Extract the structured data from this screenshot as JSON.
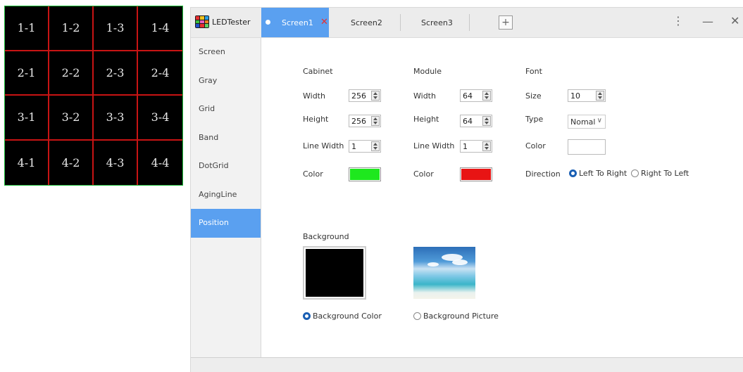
{
  "led_grid": {
    "cells": [
      "1-1",
      "1-2",
      "1-3",
      "1-4",
      "2-1",
      "2-2",
      "2-3",
      "2-4",
      "3-1",
      "3-2",
      "3-3",
      "3-4",
      "4-1",
      "4-2",
      "4-3",
      "4-4"
    ],
    "background_color": "#000000",
    "line_color": "#c81414",
    "border_color": "#1bbf3a"
  },
  "app": {
    "title": "LEDTester",
    "tabs": [
      {
        "label": "Screen1",
        "active": true
      },
      {
        "label": "Screen2",
        "active": false
      },
      {
        "label": "Screen3",
        "active": false
      }
    ],
    "add_tab_label": "+",
    "window_buttons": {
      "menu": "⋮",
      "minimize": "—",
      "close": "✕"
    },
    "tab_close": "✕"
  },
  "sidebar": {
    "items": [
      {
        "label": "Screen",
        "active": false
      },
      {
        "label": "Gray",
        "active": false
      },
      {
        "label": "Grid",
        "active": false
      },
      {
        "label": "Band",
        "active": false
      },
      {
        "label": "DotGrid",
        "active": false
      },
      {
        "label": "AgingLine",
        "active": false
      },
      {
        "label": "Position",
        "active": true
      }
    ]
  },
  "cabinet": {
    "title": "Cabinet",
    "width_label": "Width",
    "width": "256",
    "height_label": "Height",
    "height": "256",
    "line_width_label": "Line Width",
    "line_width": "1",
    "color_label": "Color",
    "color": "#1ee81e"
  },
  "module": {
    "title": "Module",
    "width_label": "Width",
    "width": "64",
    "height_label": "Height",
    "height": "64",
    "line_width_label": "Line Width",
    "line_width": "1",
    "color_label": "Color",
    "color": "#e81414"
  },
  "font": {
    "title": "Font",
    "size_label": "Size",
    "size": "10",
    "type_label": "Type",
    "type": "Nomal",
    "color_label": "Color",
    "color": "#ffffff",
    "direction_label": "Direction",
    "direction_options": [
      {
        "label": "Left To Right",
        "selected": true
      },
      {
        "label": "Right To Left",
        "selected": false
      }
    ]
  },
  "background": {
    "title": "Background",
    "options": [
      {
        "label": "Background Color",
        "selected": true
      },
      {
        "label": "Background Picture",
        "selected": false
      }
    ],
    "color": "#000000"
  },
  "accent_color": "#5aa0f0"
}
